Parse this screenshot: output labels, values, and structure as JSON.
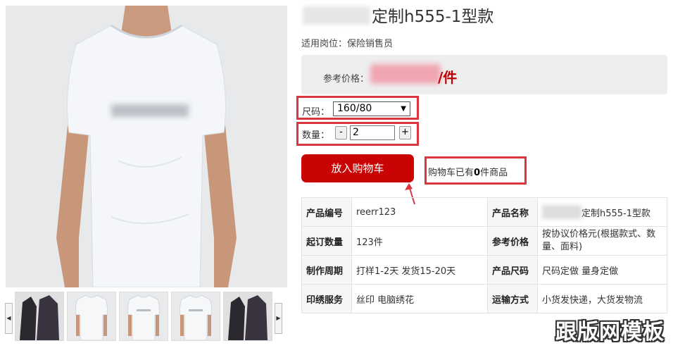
{
  "product": {
    "title_suffix": "定制h555-1型款",
    "post": "适用岗位：保险销售员",
    "price_label": "参考价格：",
    "price_unit": "/件"
  },
  "options": {
    "size_label": "尺码：",
    "size_value": "160/80",
    "qty_label": "数量：",
    "qty_minus": "-",
    "qty_plus": "+",
    "qty_value": "2"
  },
  "cart": {
    "button_label": "放入购物车",
    "status_prefix": "购物车已有",
    "status_count": "0",
    "status_suffix": "件商品"
  },
  "specs": [
    {
      "key1": "产品编号",
      "val1": "reerr123",
      "key2": "产品名称",
      "val2": "定制h555-1型款"
    },
    {
      "key1": "起订数量",
      "val1": "123件",
      "key2": "参考价格",
      "val2": "按协议价格元(根据款式、数量、面料)"
    },
    {
      "key1": "制作周期",
      "val1": "打样1-2天 发货15-20天",
      "key2": "产品尺码",
      "val2": "尺码定做 量身定做"
    },
    {
      "key1": "印绣服务",
      "val1": "丝印 电脑绣花",
      "key2": "运输方式",
      "val2": "小货发快递，大货发物流"
    }
  ],
  "gallery": {
    "prev_arrow": "◀",
    "next_arrow": "▶",
    "thumbnails": [
      "dark-coat-icon",
      "white-tshirt-icon",
      "white-tshirt-icon",
      "white-tshirt-icon",
      "dark-coat-icon"
    ]
  },
  "watermark": "跟版网模板",
  "colors": {
    "accent": "#c90404",
    "highlight_box": "#d9363e",
    "price_bg": "#eeeeee"
  }
}
